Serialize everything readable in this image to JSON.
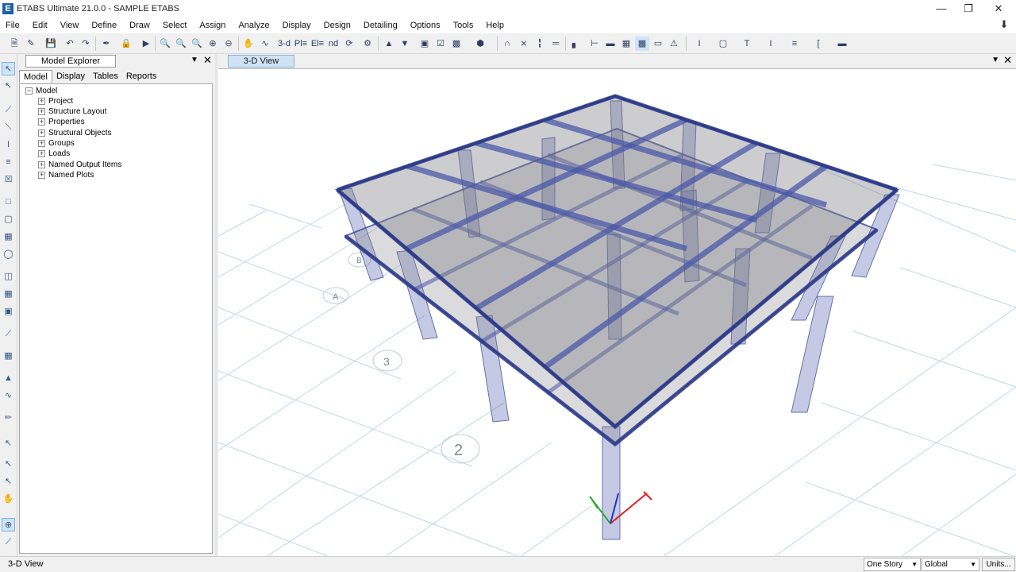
{
  "window": {
    "title": "ETABS Ultimate 21.0.0 - SAMPLE ETABS",
    "app_icon": "E"
  },
  "menu": [
    "File",
    "Edit",
    "View",
    "Define",
    "Draw",
    "Select",
    "Assign",
    "Analyze",
    "Display",
    "Design",
    "Detailing",
    "Options",
    "Tools",
    "Help"
  ],
  "toolbar": {
    "view_3d": "3-d",
    "plan": "Pl≡",
    "elev": "El≡",
    "nd": "nd"
  },
  "explorer": {
    "title": "Model Explorer",
    "tabs": [
      "Model",
      "Display",
      "Tables",
      "Reports"
    ],
    "root": "Model",
    "items": [
      "Project",
      "Structure Layout",
      "Properties",
      "Structural Objects",
      "Groups",
      "Loads",
      "Named Output Items",
      "Named Plots"
    ]
  },
  "view": {
    "tab_label": "3-D View",
    "grid_labels": [
      "2",
      "3",
      "A",
      "B"
    ]
  },
  "status": {
    "text": "3-D View",
    "story_select": "One Story",
    "coord_select": "Global",
    "units_button": "Units..."
  },
  "colors": {
    "frame": "#4a58a8",
    "slab": "#7c7c84",
    "grid": "#bcd8ee",
    "view_tab": "#cfe3f5"
  }
}
